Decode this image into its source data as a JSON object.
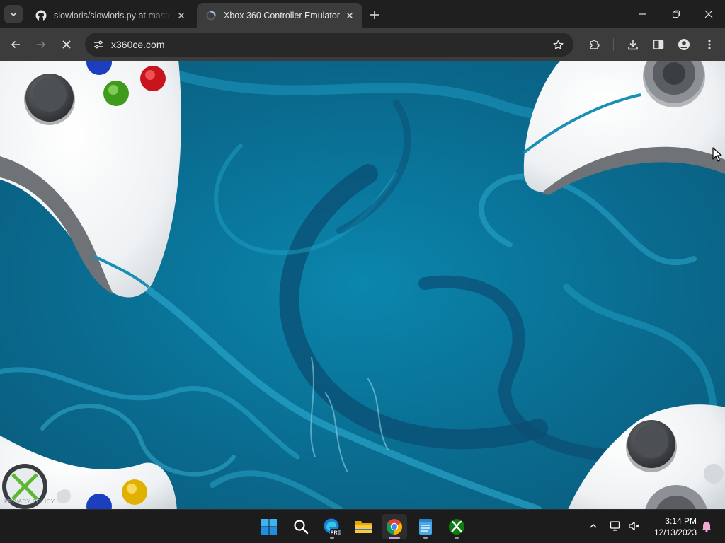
{
  "browser": {
    "tabs": [
      {
        "title": "slowloris/slowloris.py at master",
        "favicon": "github-icon",
        "active": false
      },
      {
        "title": "Xbox 360 Controller Emulator",
        "favicon": "loading-spinner-icon",
        "active": true
      }
    ],
    "address_bar": {
      "url": "x360ce.com",
      "site_info_icon": "tune-icon"
    },
    "loading": true
  },
  "page": {
    "privacy_link": "PRIVACY POLICY",
    "background_colors": {
      "base": "#0a6a8a",
      "dark": "#0b4f72",
      "swirl": "#2aa0c4"
    }
  },
  "taskbar": {
    "apps": [
      {
        "name": "start",
        "icon": "windows-icon"
      },
      {
        "name": "search",
        "icon": "search-icon"
      },
      {
        "name": "edge-preview",
        "icon": "edge-pre-icon",
        "badge": "PRE"
      },
      {
        "name": "file-explorer",
        "icon": "folder-icon"
      },
      {
        "name": "chrome",
        "icon": "chrome-icon",
        "active": true
      },
      {
        "name": "notepad",
        "icon": "notepad-icon"
      },
      {
        "name": "xbox",
        "icon": "xbox-icon"
      }
    ],
    "clock": {
      "time": "3:14 PM",
      "date": "12/13/2023"
    }
  }
}
